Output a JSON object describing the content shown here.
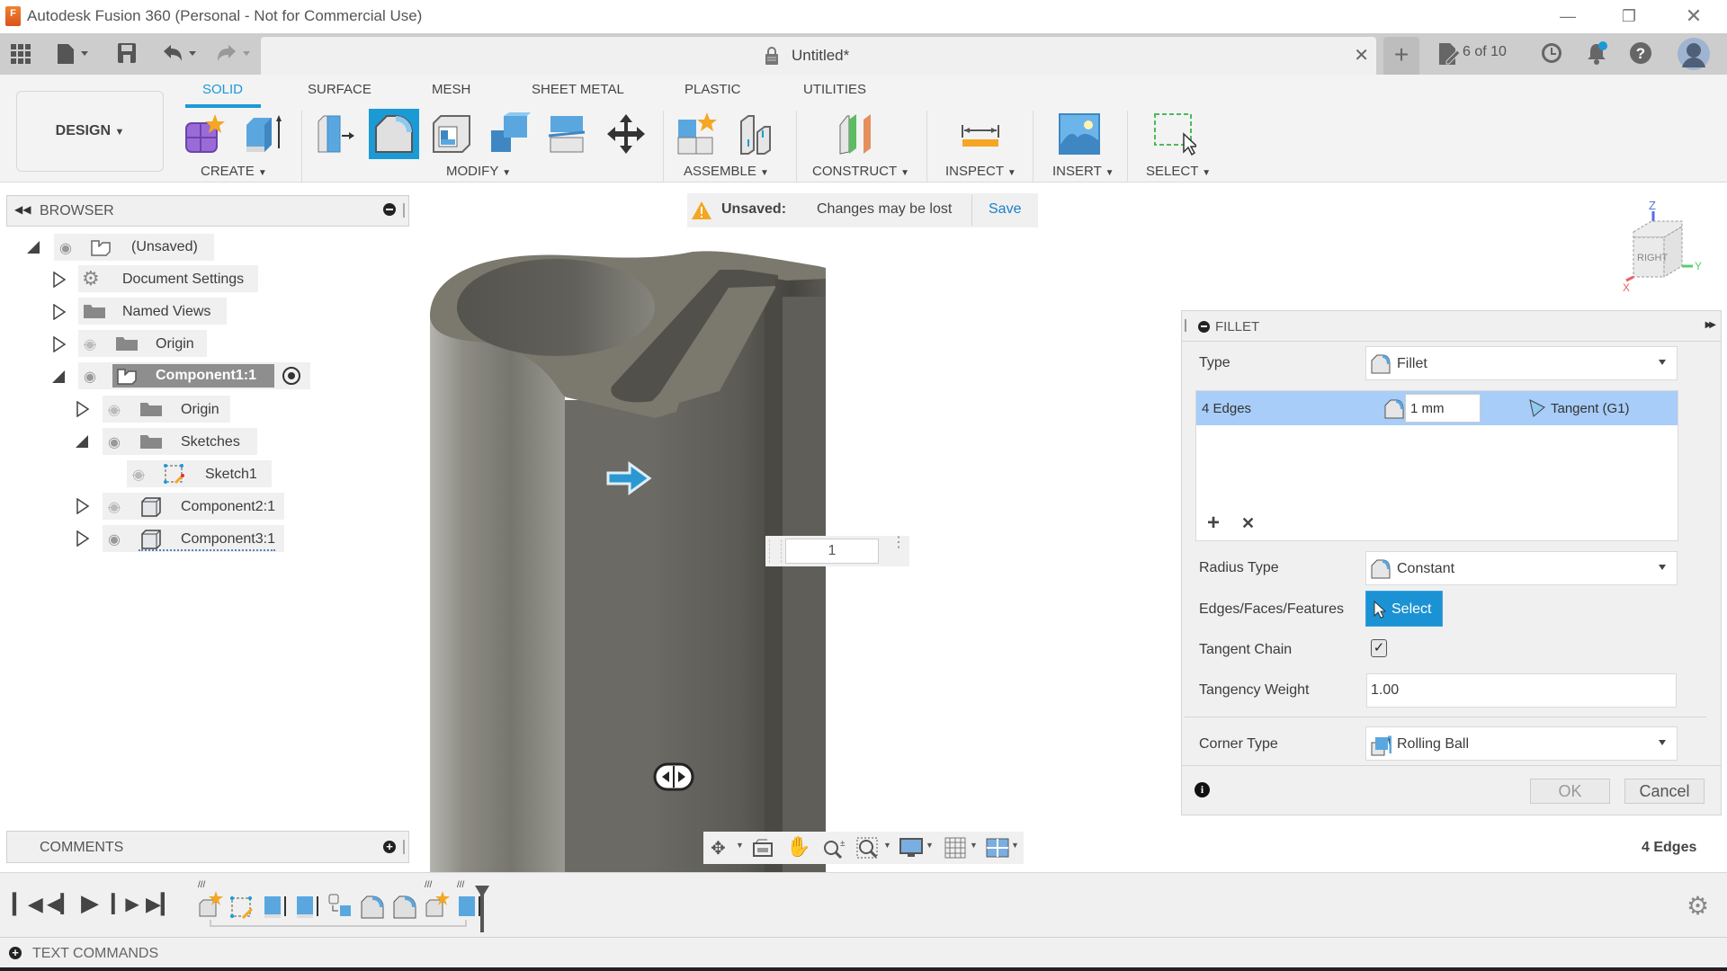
{
  "window": {
    "title": "Autodesk Fusion 360 (Personal - Not for Commercial Use)",
    "logo_letter": "F",
    "controls": [
      "minimize",
      "restore",
      "close"
    ]
  },
  "appbar": {
    "document_title": "Untitled*",
    "jobs_label": "6 of 10",
    "icons": [
      "grid-menu-icon",
      "file-icon",
      "save-icon",
      "undo-icon",
      "redo-icon",
      "lock-icon",
      "close-tab-icon",
      "new-tab-icon",
      "jobs-icon",
      "clock-icon",
      "notification-icon",
      "help-icon",
      "avatar"
    ]
  },
  "ribbon": {
    "workspace": "DESIGN",
    "tabs": [
      "SOLID",
      "SURFACE",
      "MESH",
      "SHEET METAL",
      "PLASTIC",
      "UTILITIES"
    ],
    "active_tab": "SOLID",
    "groups": [
      "CREATE",
      "MODIFY",
      "ASSEMBLE",
      "CONSTRUCT",
      "INSPECT",
      "INSERT",
      "SELECT"
    ],
    "accent": "#1b9ad6"
  },
  "browser": {
    "title": "BROWSER",
    "items": [
      {
        "label": "(Unsaved)",
        "expanded": true,
        "visible": true
      },
      {
        "label": "Document Settings",
        "expanded": false
      },
      {
        "label": "Named Views",
        "expanded": false
      },
      {
        "label": "Origin",
        "expanded": false,
        "visible": false
      },
      {
        "label": "Component1:1",
        "expanded": true,
        "visible": true,
        "active": true
      },
      {
        "label": "Origin",
        "expanded": false,
        "visible": false
      },
      {
        "label": "Sketches",
        "expanded": true,
        "visible": true
      },
      {
        "label": "Sketch1",
        "visible": false
      },
      {
        "label": "Component2:1",
        "expanded": false,
        "visible": false
      },
      {
        "label": "Component3:1",
        "expanded": false,
        "visible": true
      }
    ]
  },
  "banner": {
    "status": "Unsaved:",
    "message": "Changes may be lost",
    "action": "Save"
  },
  "viewcube": {
    "face": "RIGHT",
    "axes": [
      "Z",
      "Y",
      "X"
    ]
  },
  "radius_input": {
    "value": "1"
  },
  "fillet": {
    "title": "FILLET",
    "type_label": "Type",
    "type_value": "Fillet",
    "edge_set": {
      "label": "4 Edges",
      "radius": "1 mm",
      "continuity": "Tangent (G1)"
    },
    "radius_type_label": "Radius Type",
    "radius_type_value": "Constant",
    "selection_label": "Edges/Faces/Features",
    "select_button": "Select",
    "tangent_chain_label": "Tangent Chain",
    "tangent_chain_checked": true,
    "tangency_weight_label": "Tangency Weight",
    "tangency_weight_value": "1.00",
    "corner_type_label": "Corner Type",
    "corner_type_value": "Rolling Ball",
    "ok": "OK",
    "cancel": "Cancel"
  },
  "selection_status": "4 Edges",
  "comments": {
    "title": "COMMENTS"
  },
  "text_commands": {
    "title": "TEXT COMMANDS"
  },
  "timeline": {
    "features": [
      "component",
      "sketch",
      "extrude",
      "extrude",
      "joint",
      "fillet",
      "fillet",
      "component",
      "extrude"
    ]
  }
}
